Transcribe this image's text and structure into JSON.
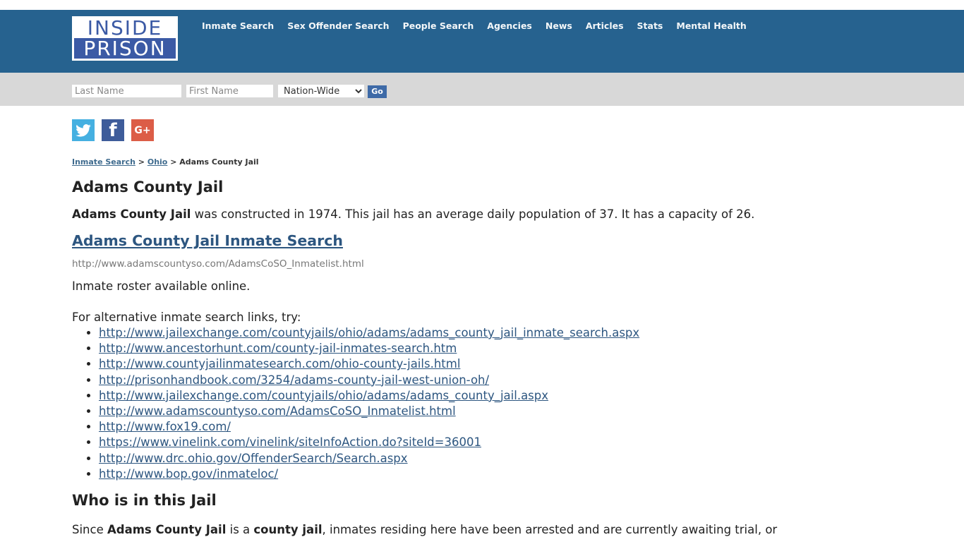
{
  "header": {
    "logo": {
      "line1": "INSIDE",
      "line2": "PRISON"
    },
    "nav": [
      {
        "label": "Inmate Search"
      },
      {
        "label": "Sex Offender Search"
      },
      {
        "label": "People Search"
      },
      {
        "label": "Agencies"
      },
      {
        "label": "News"
      },
      {
        "label": "Articles"
      },
      {
        "label": "Stats"
      },
      {
        "label": "Mental Health"
      }
    ],
    "colors": {
      "header_bg": "#26628f",
      "searchbar_bg": "#d8d8d8",
      "logo_blue": "#3b5aa5"
    }
  },
  "search": {
    "last_name_placeholder": "Last Name",
    "first_name_placeholder": "First Name",
    "location_selected": "Nation-Wide",
    "go_label": "Go"
  },
  "social": {
    "twitter": {
      "icon": "twitter-icon",
      "color": "#45b0e1"
    },
    "facebook": {
      "icon": "facebook-icon",
      "glyph": "f",
      "color": "#3e5c9a"
    },
    "googleplus": {
      "icon": "google-plus-icon",
      "glyph": "G+",
      "color": "#dc5d47"
    }
  },
  "breadcrumb": {
    "items": [
      {
        "label": "Inmate Search"
      },
      {
        "label": "Ohio"
      }
    ],
    "separator": ">",
    "current": "Adams County Jail"
  },
  "page": {
    "title": "Adams County Jail",
    "intro_bold": "Adams County Jail",
    "intro_rest": " was constructed in 1974. This jail has an average daily population of 37. It has a capacity of 26.",
    "search_link": "Adams County Jail Inmate Search",
    "search_url": "http://www.adamscountyso.com/AdamsCoSO_Inmatelist.html",
    "roster_text": "Inmate roster available online.",
    "alt_intro": "For alternative inmate search links, try:",
    "alt_links": [
      "http://www.jailexchange.com/countyjails/ohio/adams/adams_county_jail_inmate_search.aspx",
      "http://www.ancestorhunt.com/county-jail-inmates-search.htm",
      "http://www.countyjailinmatesearch.com/ohio-county-jails.html",
      "http://prisonhandbook.com/3254/adams-county-jail-west-union-oh/",
      "http://www.jailexchange.com/countyjails/ohio/adams/adams_county_jail.aspx",
      "http://www.adamscountyso.com/AdamsCoSO_Inmatelist.html",
      "http://www.fox19.com/",
      "https://www.vinelink.com/vinelink/siteInfoAction.do?siteId=36001",
      "http://www.drc.ohio.gov/OffenderSearch/Search.aspx",
      "http://www.bop.gov/inmateloc/"
    ],
    "who_heading": "Who is in this Jail",
    "who_text": {
      "p1": "Since ",
      "b1": "Adams County Jail",
      "p2": " is a ",
      "b2": "county jail",
      "p3": ", inmates residing here have been arrested and are currently awaiting trial, or"
    }
  }
}
